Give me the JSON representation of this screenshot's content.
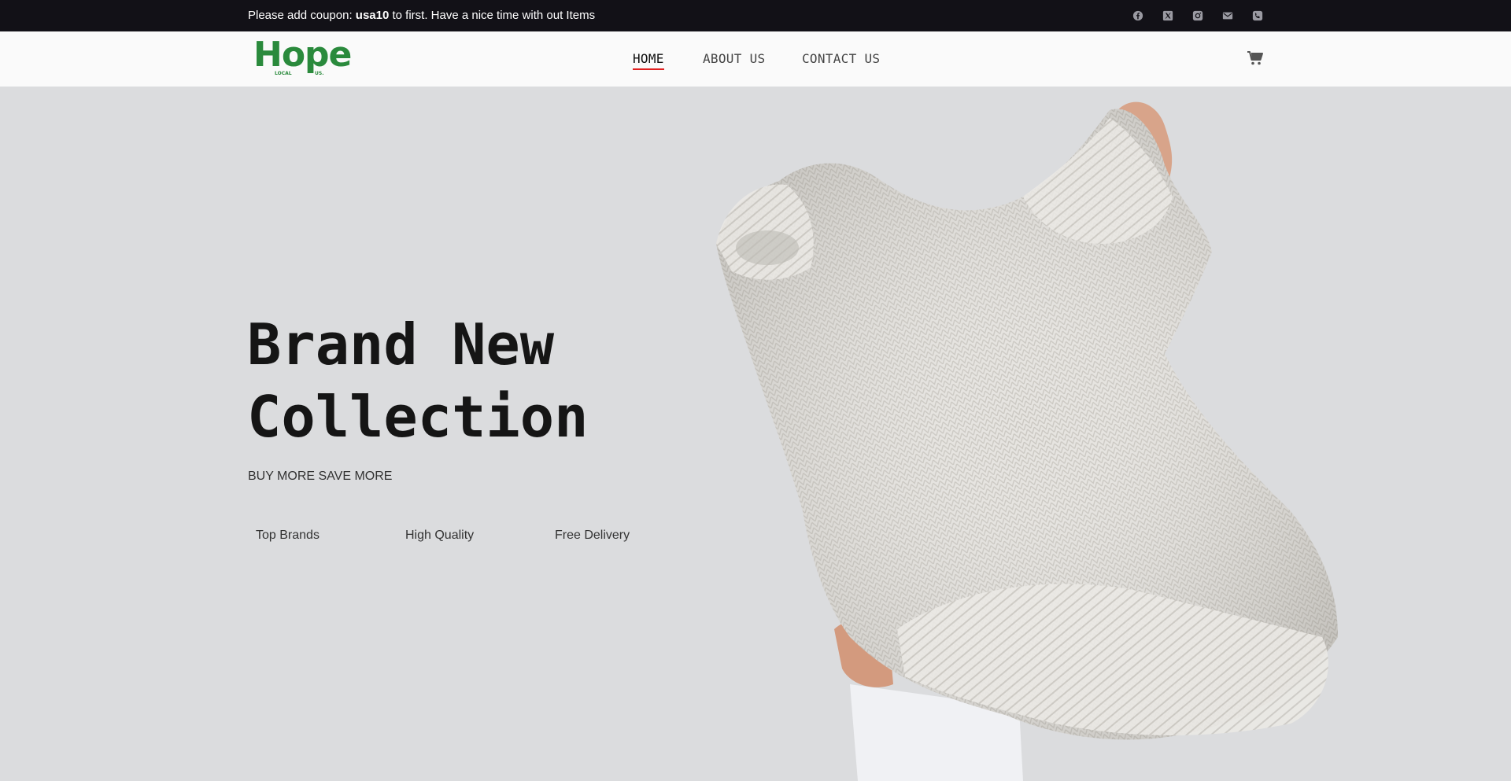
{
  "announcement": {
    "prefix": "Please add coupon: ",
    "coupon": "usa10",
    "suffix": " to first. Have a nice time with out Items"
  },
  "social_icons": [
    "facebook-icon",
    "x-twitter-icon",
    "instagram-icon",
    "email-icon",
    "phone-icon"
  ],
  "logo": {
    "text": "Hope",
    "tagline_left": "LOCAL",
    "tagline_right": "US.",
    "color": "#2a8a3c"
  },
  "nav": {
    "items": [
      {
        "label": "HOME",
        "active": true
      },
      {
        "label": "ABOUT US",
        "active": false
      },
      {
        "label": "CONTACT US",
        "active": false
      }
    ],
    "active_underline_color": "#e02020"
  },
  "cart_icon": "cart-icon",
  "hero": {
    "title_line1": "Brand New",
    "title_line2": "Collection",
    "subtitle": "BUY MORE SAVE MORE",
    "features": [
      "Top Brands",
      "High Quality",
      "Free Delivery"
    ],
    "background": "#dbdcde"
  },
  "colors": {
    "topbar_bg": "#121117",
    "navbar_bg": "#fafafa"
  }
}
